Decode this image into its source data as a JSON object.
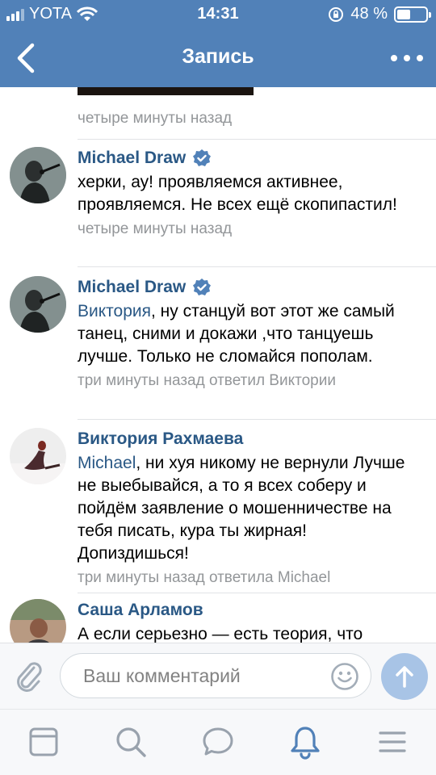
{
  "status_bar": {
    "carrier": "YOTA",
    "time": "14:31",
    "battery_text": "48 %",
    "battery_level": 0.48
  },
  "nav": {
    "title": "Запись"
  },
  "feed": {
    "top_time": "четыре минуты назад",
    "comments": [
      {
        "author": "Michael Draw",
        "verified": true,
        "mention": "",
        "text": "херки, ау! проявляемся активнее, проявляемся. Не всех ещё скопипастил!",
        "meta": "четыре минуты назад"
      },
      {
        "author": "Michael Draw",
        "verified": true,
        "mention": "Виктория",
        "text": ", ну станцуй вот этот же самый танец, сними и докажи ,что танцуешь лучше. Только не сломайся пополам.",
        "meta": "три минуты назад ответил Виктории"
      },
      {
        "author": "Виктория Рахмаева",
        "verified": false,
        "mention": "Michael",
        "text": ", ни хуя никому не вернули Лучше не выебывайся, а то я всех соберу и пойдём заявление о мошенничестве на тебя писать, кура ты жирная! Допиздишься!",
        "meta": "три минуты назад ответила Michael"
      },
      {
        "author": "Саша Арламов",
        "verified": false,
        "mention": "",
        "text": "А если серьезно — есть теория, что",
        "meta": ""
      }
    ]
  },
  "composer": {
    "placeholder": "Ваш комментарий"
  },
  "tabbar": {
    "items": [
      "news-icon",
      "search-icon",
      "messages-icon",
      "notifications-icon",
      "menu-icon"
    ],
    "active": "notifications-icon"
  },
  "colors": {
    "header": "#5181b8",
    "link": "#2a5885",
    "meta": "#939699",
    "send": "#a8c4e6"
  }
}
